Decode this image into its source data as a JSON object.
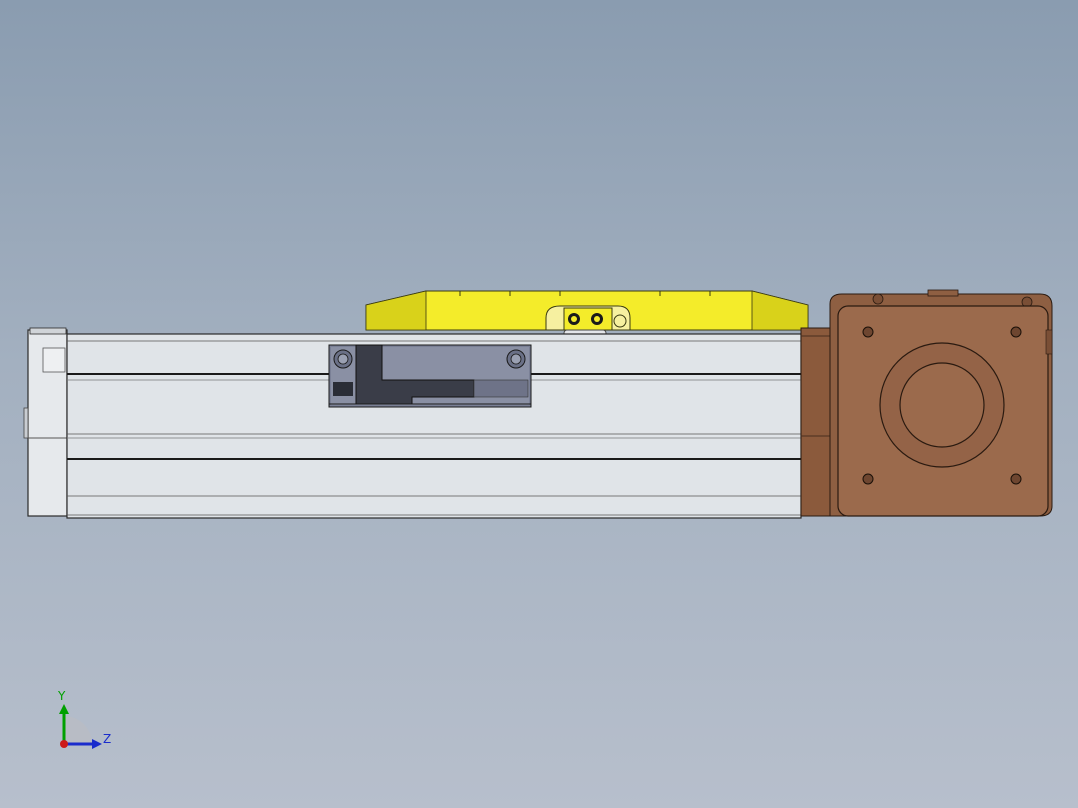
{
  "viewport": {
    "background_top": "#8a9cb0",
    "background_bottom": "#b7bfcc"
  },
  "model": {
    "parts": [
      "linear-rail-body",
      "carriage-plate",
      "sensor-bracket",
      "motor-adapter",
      "servo-motor"
    ],
    "colors": {
      "rail": "#e0e4e8",
      "rail_edge": "#2a2a2a",
      "carriage": "#f4ec2a",
      "bracket": "#7a8096",
      "motor": "#9b6a4c",
      "motor_dark": "#7a4f36"
    }
  },
  "triad": {
    "y_label": "Y",
    "z_label": "Z",
    "colors": {
      "y": "#00a000",
      "z": "#1a2ccc",
      "x": "#cc1a1a"
    }
  }
}
